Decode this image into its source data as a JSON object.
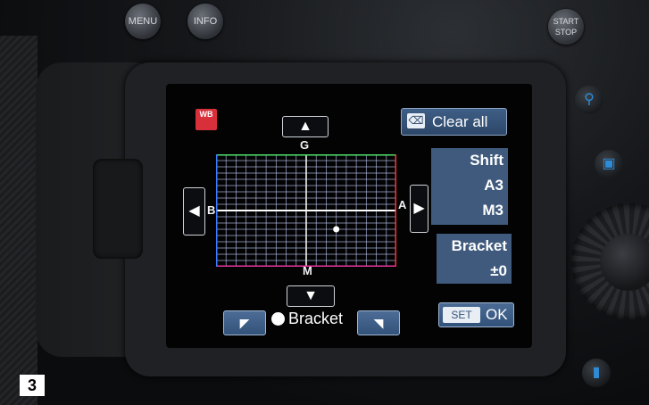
{
  "camera": {
    "buttons": {
      "menu_label": "MENU",
      "info_label": "INFO",
      "start_stop_label_1": "START",
      "start_stop_label_2": "STOP"
    }
  },
  "screen": {
    "wb_icon_text": "WB",
    "clear_all_label": "Clear all",
    "grid": {
      "top_letter": "G",
      "bottom_letter": "M",
      "left_letter": "B",
      "right_letter": "A",
      "marker_shift_a": 3,
      "marker_shift_m": 3,
      "colors": {
        "top_edge": "#4fe06a",
        "bottom_edge": "#e8359c",
        "left_edge": "#3e7dff",
        "right_edge": "#ff3030",
        "grid_lines": "#c9d3ff"
      }
    },
    "shift": {
      "title": "Shift",
      "value_1": "A3",
      "value_2": "M3"
    },
    "bracket": {
      "title": "Bracket",
      "value": "±0"
    },
    "bracket_control_label": "Bracket",
    "set_label": "SET",
    "ok_label": "OK"
  },
  "figure_label": "3",
  "icons": [
    "wb-icon",
    "erase-icon",
    "arrow-up-icon",
    "arrow-down-icon",
    "arrow-left-icon",
    "arrow-right-icon",
    "dial-left-icon",
    "dial-right-icon",
    "bracket-dot-icon"
  ]
}
